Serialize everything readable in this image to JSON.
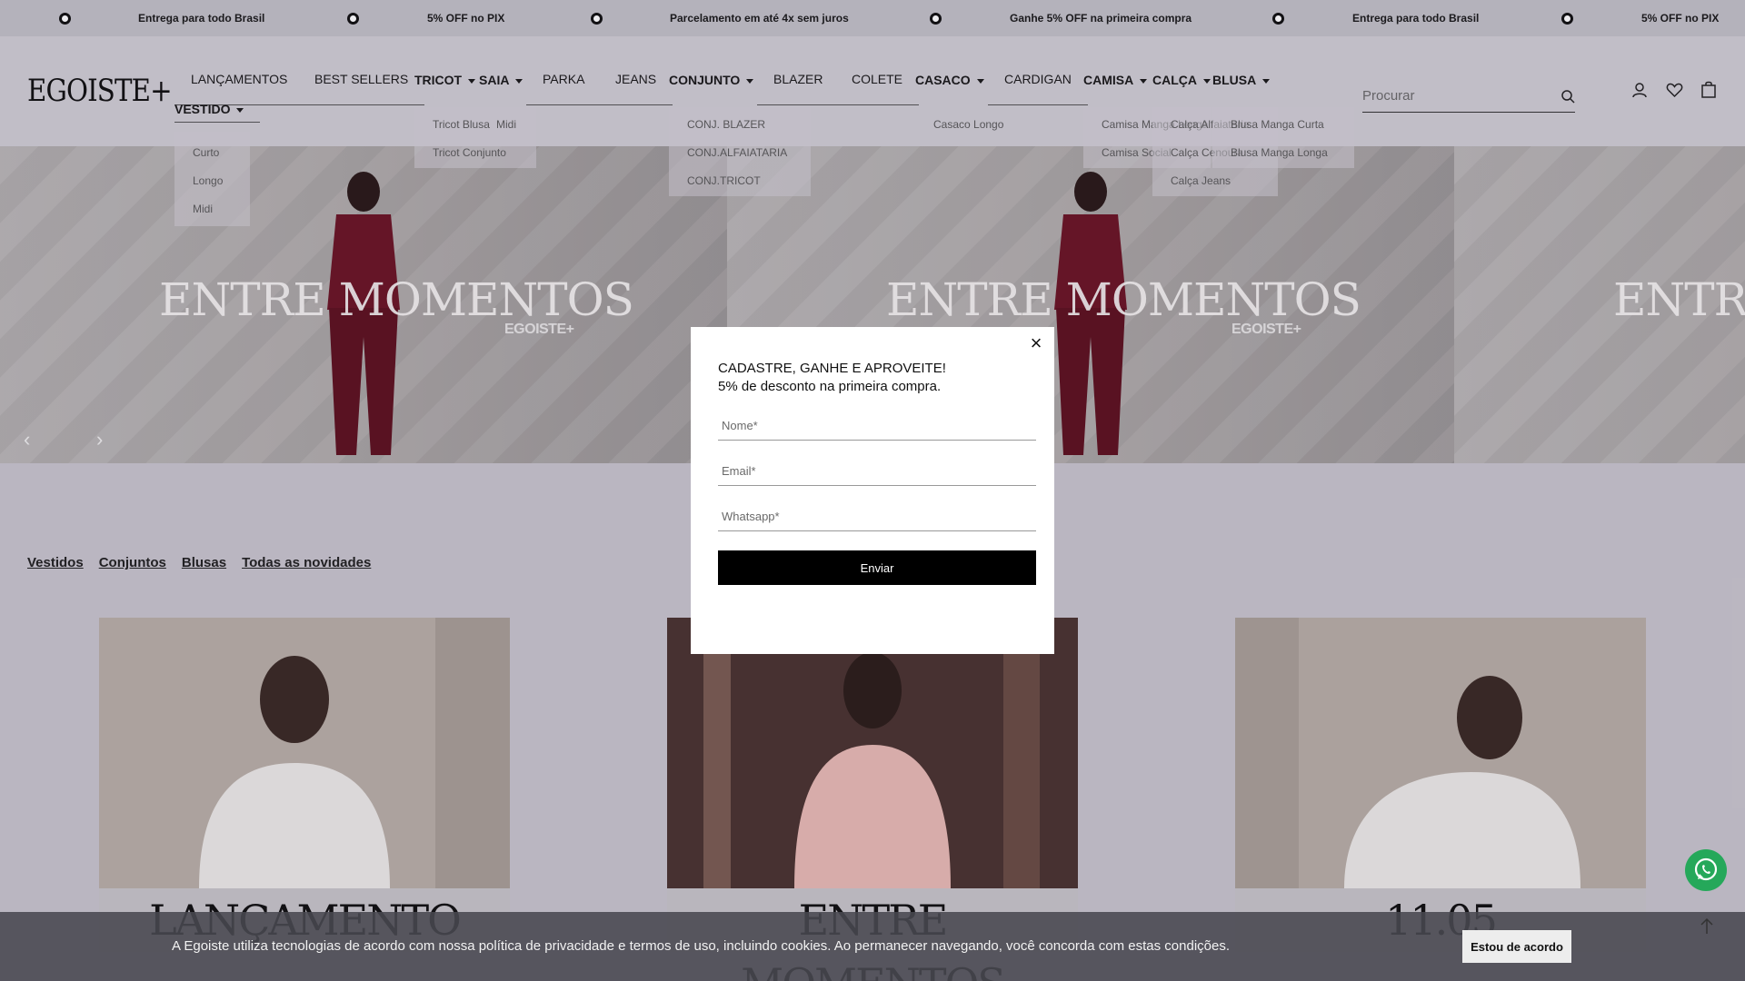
{
  "announcements": [
    "Entrega para todo Brasil",
    "5% OFF no PIX",
    "Parcelamento em até 4x sem juros",
    "Ganhe 5% OFF na primeira compra",
    "Entrega para todo Brasil",
    "5% OFF no PIX"
  ],
  "header": {
    "logo": "EGOISTE+",
    "nav": {
      "lancamentos": "LANÇAMENTOS",
      "best_sellers": "BEST SELLERS",
      "tricot": "TRICOT",
      "saia": "SAIA",
      "parka": "PARKA",
      "jeans": "JEANS",
      "conjunto": "CONJUNTO",
      "blazer": "BLAZER",
      "colete": "COLETE",
      "casaco": "CASACO",
      "cardigan": "CARDIGAN",
      "camisa": "CAMISA",
      "calca": "CALÇA",
      "blusa": "BLUSA",
      "vestido": "VESTIDO"
    },
    "dropdowns": {
      "vestido": [
        "Curto",
        "Longo",
        "Midi"
      ],
      "tricot": [
        "Tricot Blusa",
        "Tricot Conjunto"
      ],
      "saia": [
        "Midi"
      ],
      "conjunto": [
        "CONJ. BLAZER",
        "CONJ.ALFAIATARIA",
        "CONJ.TRICOT"
      ],
      "casaco": [
        "Casaco Longo"
      ],
      "camisa": [
        "Camisa Manga Longa",
        "Camisa Social"
      ],
      "calca": [
        "Calça Alfaiataria",
        "Calça Cenoura",
        "Calça Jeans"
      ],
      "blusa": [
        "Blusa Manga Curta",
        "Blusa Manga Longa"
      ]
    },
    "search_placeholder": "Procurar"
  },
  "hero": {
    "slide_title": "ENTRE MOMENTOS",
    "slide_brand": "EGOISTE+",
    "prev": "‹",
    "next": "›"
  },
  "categories": [
    "Vestidos",
    "Conjuntos",
    "Blusas",
    "Todas as novidades"
  ],
  "cards": [
    "LANÇAMENTO",
    "ENTRE MOMENTOS",
    "11.05"
  ],
  "modal": {
    "title": "CADASTRE, GANHE E APROVEITE!",
    "subtitle": "5% de desconto na primeira compra.",
    "name_placeholder": "Nome*",
    "email_placeholder": "Email*",
    "whatsapp_placeholder": "Whatsapp*",
    "submit": "Enviar",
    "close": "×"
  },
  "cookie": {
    "text": "A Egoiste utiliza tecnologias de acordo com nossa política de privacidade e termos de uso, incluindo cookies. Ao permanecer navegando, você concorda com estas condições.",
    "accept": "Estou de acordo"
  },
  "colors": {
    "accent": "#000000",
    "whatsapp": "#25a85a",
    "outfit": "#6b1525"
  }
}
